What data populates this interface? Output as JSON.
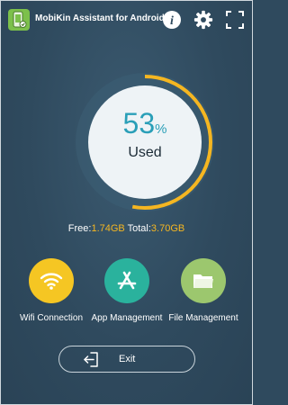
{
  "header": {
    "title": "MobiKin Assistant for Android",
    "logo_icon": "android-phone-icon",
    "actions": [
      {
        "name": "info",
        "icon": "info-icon"
      },
      {
        "name": "settings",
        "icon": "gear-icon"
      },
      {
        "name": "scan",
        "icon": "scan-frame-icon"
      }
    ]
  },
  "storage": {
    "percent_value": "53",
    "percent_sign": "%",
    "used_fraction": 0.53,
    "used_label": "Used",
    "free_label": "Free:",
    "free_value": "1.74GB",
    "total_label": "Total:",
    "total_value": "3.70GB"
  },
  "features": [
    {
      "label": "Wifi Connection",
      "icon": "wifi-icon",
      "color": "#f5c623"
    },
    {
      "label": "App Management",
      "icon": "app-store-icon",
      "color": "#2ab29d"
    },
    {
      "label": "File Management",
      "icon": "folder-icon",
      "color": "#9cc76e"
    }
  ],
  "exit": {
    "label": "Exit",
    "icon": "exit-door-icon"
  },
  "colors": {
    "background": "#2f4a5e",
    "accent_gauge": "#f5b621",
    "percent_text": "#2a9fb8"
  }
}
